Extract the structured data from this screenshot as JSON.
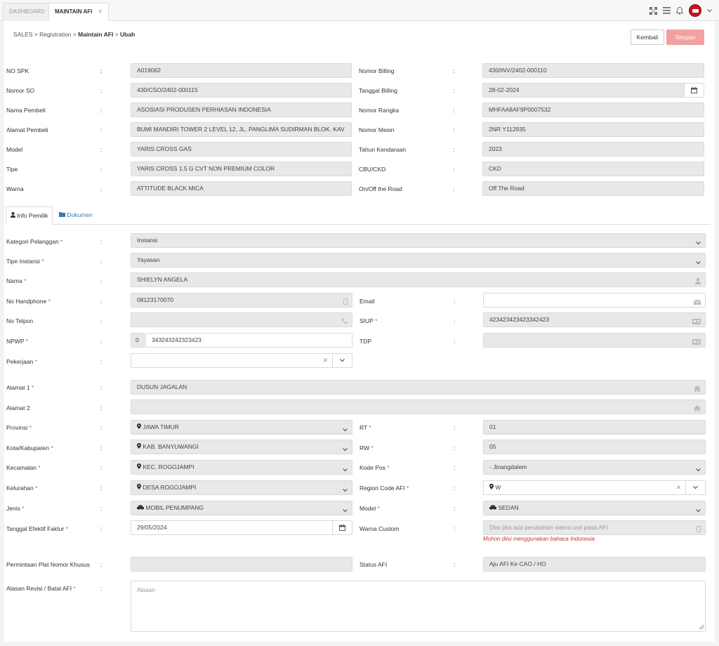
{
  "tabs": [
    {
      "label": "DASHBOARD"
    },
    {
      "label": "MAINTAIN AFI"
    }
  ],
  "breadcrumb": {
    "root": "SALES",
    "l1": "Registration",
    "l2": "Maintain AFI",
    "l3": "Ubah"
  },
  "buttons": {
    "back": "Kembali",
    "save": "Simpan"
  },
  "header_fields": {
    "no_spk": {
      "label": "NO SPK",
      "value": "A019062"
    },
    "nomor_so": {
      "label": "Nomor SO",
      "value": "430/CSO/2402-000115"
    },
    "nama_pembeli": {
      "label": "Nama Pembeli",
      "value": "ASOSIASI PRODUSEN PERHIASAN INDONESIA"
    },
    "alamat_pembeli": {
      "label": "Alamat Pembeli",
      "value": "BUMI MANDIRI TOWER 2 LEVEL 12, JL. PANGLIMA SUDIRMAN BLOK. KAV"
    },
    "model": {
      "label": "Model",
      "value": "YARIS CROSS GAS"
    },
    "tipe": {
      "label": "Tipe",
      "value": "YARIS CROSS 1.5 G CVT NON PREMIUM COLOR"
    },
    "warna": {
      "label": "Warna",
      "value": "ATTITUDE BLACK MICA"
    },
    "nomor_billing": {
      "label": "Nomor Billing",
      "value": "430/INV/2402-000110"
    },
    "tanggal_billing": {
      "label": "Tanggal Billing",
      "value": "28-02-2024"
    },
    "nomor_rangka": {
      "label": "Nomor Rangka",
      "value": "MHFAA8AF9P0007532"
    },
    "nomor_mesin": {
      "label": "Nomor Mesin",
      "value": "2NR Y112935"
    },
    "tahun_kendaraan": {
      "label": "Tahun Kendaraan",
      "value": "2023"
    },
    "cbu_ckd": {
      "label": "CBU/CKD",
      "value": "CKD"
    },
    "on_off_road": {
      "label": "On/Off the Road",
      "value": "Off The Road"
    }
  },
  "section_tabs": {
    "info": "Info Pemilik",
    "dokumen": "Dokumen"
  },
  "form": {
    "kategori": {
      "label": "Kategori Pelanggan",
      "value": "Instansi"
    },
    "tipe_instansi": {
      "label": "Tipe Instansi",
      "value": "Yayasan"
    },
    "nama": {
      "label": "Nama",
      "value": "SHIELYN ANGELA"
    },
    "no_hp": {
      "label": "No Handphone",
      "value": "08123170070"
    },
    "email": {
      "label": "Email",
      "value": ""
    },
    "no_telpon": {
      "label": "No Telpon",
      "value": ""
    },
    "siup": {
      "label": "SIUP",
      "value": "423423423423342423"
    },
    "npwp": {
      "label": "NPWP",
      "prefix": "0",
      "value": "343243242323423"
    },
    "tdp": {
      "label": "TDP",
      "value": ""
    },
    "pekerjaan": {
      "label": "Pekerjaan",
      "value": ""
    },
    "alamat1": {
      "label": "Alamat 1",
      "value": "DUSUN JAGALAN"
    },
    "alamat2": {
      "label": "Alamat 2",
      "value": ""
    },
    "provinsi": {
      "label": "Provinsi",
      "value": "JAWA TIMUR"
    },
    "rt": {
      "label": "RT",
      "value": "01"
    },
    "kota": {
      "label": "Kota/Kabupaten",
      "value": "KAB. BANYUWANGI"
    },
    "rw": {
      "label": "RW",
      "value": "05"
    },
    "kecamatan": {
      "label": "Kecamatan",
      "value": "KEC. ROGOJAMPI"
    },
    "kode_pos": {
      "label": "Kode Pos",
      "value": "- Jinangdalem"
    },
    "kelurahan": {
      "label": "Kelurahan",
      "value": "DESA ROGOJAMPI"
    },
    "region_code": {
      "label": "Region Code AFI",
      "value": "W"
    },
    "jenis": {
      "label": "Jenis",
      "value": "MOBIL PENUMPANG"
    },
    "model": {
      "label": "Model",
      "value": "SEDAN"
    },
    "tgl_efektif": {
      "label": "Tanggal Efektif Faktur",
      "value": "29/05/2024"
    },
    "warna_custom": {
      "label": "Warna Custom",
      "placeholder": "Diisi jika ada perubahan warna unit pada AFI",
      "note": "Mohon diisi menggunakan bahasa Indonesia"
    },
    "plat_khusus": {
      "label": "Permintaan Plat Nomor Khusus",
      "value": ""
    },
    "status_afi": {
      "label": "Status AFI",
      "value": "Aju AFI Ke CAO / HO"
    },
    "alasan": {
      "label": "Alasan Revisi / Batal AFI",
      "placeholder": "Alasan"
    }
  },
  "colon": ":",
  "required_mark": "*"
}
